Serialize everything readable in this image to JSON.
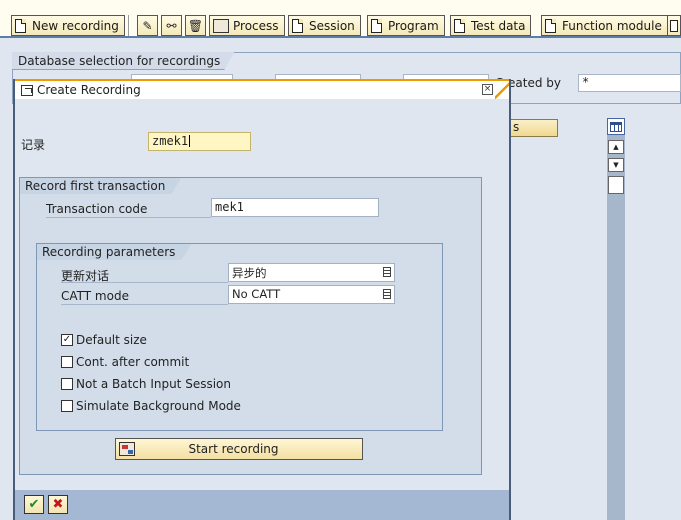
{
  "toolbar": {
    "new_recording": "New recording",
    "process": "Process",
    "session": "Session",
    "program": "Program",
    "test_data": "Test data",
    "function_module": "Function module"
  },
  "background": {
    "frame_title": "Database selection for recordings",
    "created_by_label": "Created by",
    "created_by_value": "*",
    "column_header_fragment": "s"
  },
  "dialog": {
    "title": "Create Recording",
    "recording_label": "记录",
    "recording_value": "zmek1",
    "first_tx_group": "Record first transaction",
    "tcode_label": "Transaction code",
    "tcode_value": "mek1",
    "params_group": "Recording parameters",
    "update_mode_label": "更新对话",
    "update_mode_value": "异步的",
    "catt_label": "CATT mode",
    "catt_value": "No CATT",
    "checkboxes": [
      {
        "label": "Default size",
        "checked": true
      },
      {
        "label": "Cont. after commit",
        "checked": false
      },
      {
        "label": "Not a Batch Input Session",
        "checked": false
      },
      {
        "label": "Simulate Background Mode",
        "checked": false
      }
    ],
    "start_button": "Start recording",
    "ok_icon": "check-icon",
    "cancel_icon": "cancel-icon"
  },
  "colors": {
    "accent_orange": "#ef9b00",
    "panel_blue": "#dfe6ef",
    "button_yellow": "#f3dfa3",
    "footer_blue": "#a4b8d4"
  }
}
